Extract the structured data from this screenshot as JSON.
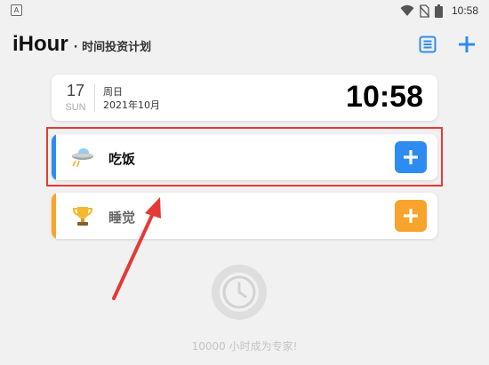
{
  "status_bar": {
    "app_badge": "A",
    "time": "10:58"
  },
  "header": {
    "app_name": "iHour",
    "tagline": "· 时间投资计划"
  },
  "date_card": {
    "day": "17",
    "weekday_en": "SUN",
    "weekday_cn": "周日",
    "year_month": "2021年10月",
    "clock": "10:58"
  },
  "tasks": [
    {
      "label": "吃饭",
      "icon": "ufo-icon",
      "accent": "#2e8cf0",
      "label_color": "#111111"
    },
    {
      "label": "睡觉",
      "icon": "trophy-icon",
      "accent": "#f8a32c",
      "label_color": "#666666"
    }
  ],
  "footer": {
    "motto": "10000 小时成为专家!"
  },
  "colors": {
    "blue": "#2e8cf0",
    "orange": "#f8a32c",
    "annotation_red": "#e53935"
  }
}
